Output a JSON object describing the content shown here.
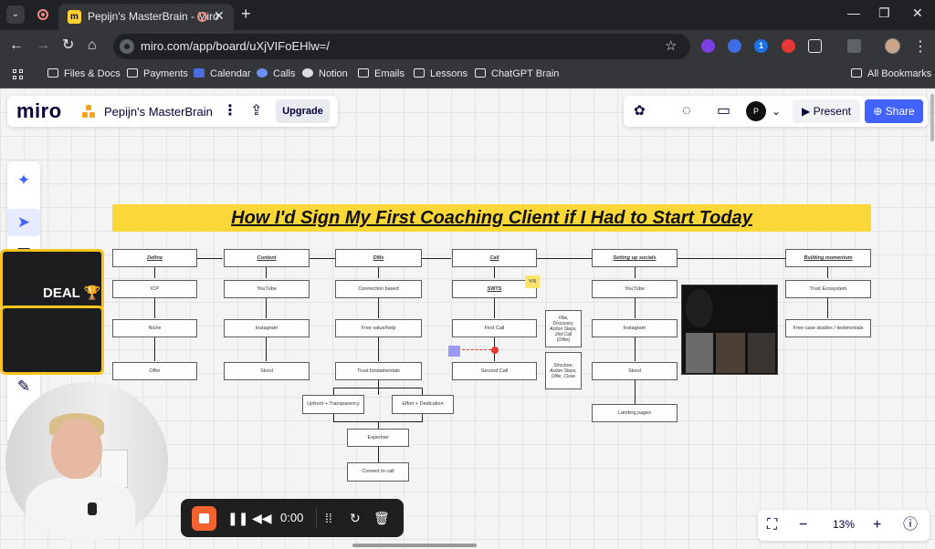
{
  "browser": {
    "tab_title": "Pepijn's MasterBrain - Miro",
    "tab_close": "✕",
    "new_tab": "+",
    "url": "miro.com/app/board/uXjVIFoEHlw=/",
    "window_controls": {
      "minimize": "—",
      "restore": "❐",
      "close": "✕"
    }
  },
  "bookmarks": [
    "Files & Docs",
    "Payments",
    "Calendar",
    "Calls",
    "Notion",
    "Emails",
    "Lessons",
    "ChatGPT Brain",
    "All Bookmarks"
  ],
  "miro": {
    "logo": "miro",
    "board_title": "Pepijn's MasterBrain",
    "upgrade": "Upgrade",
    "present": "Present",
    "share": "Share",
    "zoom": "13%",
    "user_initials": "P"
  },
  "board": {
    "banner": "How I'd Sign My First Coaching Client if I Had to Start Today",
    "deal_text": "DEAL 🏆",
    "sticky_yn": "Y/N",
    "columns": {
      "define": {
        "header": "Define",
        "items": [
          "ICP",
          "Niche",
          "Offer"
        ]
      },
      "content": {
        "header": "Content",
        "items": [
          "YouTube",
          "Instagram",
          "Skool"
        ]
      },
      "dms": {
        "header": "DMs",
        "items": [
          "Connection based",
          "Free value/help",
          "Trust fundamentals",
          "Upfront + Transparency",
          "Effort + Dedication",
          "Expertise",
          "Convert to call"
        ]
      },
      "call": {
        "header": "Call",
        "items": [
          "SWTS",
          "First Call",
          "Second Call"
        ]
      },
      "call_notes": [
        "Vibe, Discovery, Action Steps, 2nd Call (Offer)",
        "Structure, Action Steps, Offer, Close"
      ],
      "socials": {
        "header": "Setting up socials",
        "items": [
          "YouTube",
          "Instagram",
          "Skool",
          "Landing pages"
        ]
      },
      "momentum": {
        "header": "Building momentum",
        "items": [
          "Trust Ecosystem",
          "Free case studies / testimonials"
        ]
      }
    }
  },
  "recorder": {
    "time": "0:00"
  }
}
